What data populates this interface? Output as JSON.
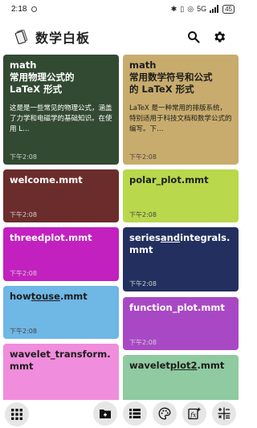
{
  "status_bar": {
    "time": "2:18",
    "network": "5G",
    "battery": "45"
  },
  "app": {
    "title": "数学白板"
  },
  "notes": {
    "left": [
      {
        "title_line1": "math",
        "title_line2": "常用物理公式的",
        "title_line3": "LaTeX 形式",
        "body": "这是是一些常见的物理公式，涵盖了力学和电磁学的基础知识。在使用 L…",
        "time": "下午2:08",
        "color": "#334a32"
      },
      {
        "title": "welcome.mmt",
        "time": "下午2:08",
        "color": "#6b2d2b"
      },
      {
        "title": "threedplot.mmt",
        "time": "下午2:08",
        "color": "#c320c0"
      },
      {
        "title": "howtouse.mmt",
        "title_plain_a": "how",
        "title_under": "touse",
        "title_plain_b": ".mmt",
        "time": "下午2:08",
        "color": "#6fb7e5"
      },
      {
        "title_line1": "wavelet_transform.",
        "title_line2": "mmt",
        "color": "#f08ddc"
      }
    ],
    "right": [
      {
        "title_line1": "math",
        "title_line2": "常用数学符号和公式",
        "title_line3": "的 LaTeX 形式",
        "body": "LaTeX 是一种常用的排版系统，特别适用于科技文档和数学公式的编写。下…",
        "time": "下午2:08",
        "color": "#c8ac6d"
      },
      {
        "title": "polar_plot.mmt",
        "time": "下午2:08",
        "color": "#b9d84c"
      },
      {
        "title_line1": "seriesandintegrals.",
        "title_line2": "mmt",
        "title_plain_a": "series",
        "title_under": "and",
        "title_plain_b": "integrals.",
        "time": "下午2:08",
        "color": "#23305f"
      },
      {
        "title": "function_plot.mmt",
        "time": "下午2:08",
        "color": "#a948c4"
      },
      {
        "title_line1": "waveletplot2.mmt",
        "title_plain_a": "wavelet",
        "title_under": "plot2",
        "title_plain_b": ".mmt",
        "color": "#8fcaa0"
      }
    ]
  },
  "bottom_bar": {
    "icons": [
      "apps-grid-icon",
      "new-folder-icon",
      "list-view-icon",
      "palette-icon",
      "new-formula-icon",
      "calculator-icon"
    ]
  }
}
